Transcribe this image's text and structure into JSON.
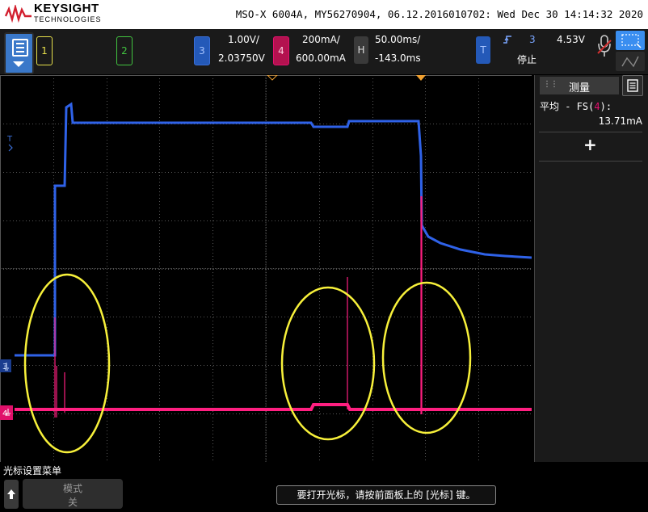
{
  "header": {
    "brand": "KEYSIGHT",
    "brand_sub": "TECHNOLOGIES",
    "model_info": "MSO-X 6004A, MY56270904, 06.12.2016010702: Wed Dec 30 14:14:32 2020"
  },
  "channels": [
    {
      "number": "1",
      "color": "#e7e04b"
    },
    {
      "number": "2",
      "color": "#42c540"
    },
    {
      "number": "3",
      "color": "#3a6fd8",
      "scale": "1.00V/",
      "offset": "2.03750V"
    },
    {
      "number": "4",
      "color": "#e5106f",
      "scale": "200mA/",
      "offset": "600.00mA"
    }
  ],
  "horizontal": {
    "label": "H",
    "timebase": "50.00ms/",
    "delay": "-143.0ms"
  },
  "trigger": {
    "label": "T",
    "source": "3",
    "level": "4.53V",
    "status": "停止"
  },
  "measurements": {
    "title": "测量",
    "label_prefix": "平均 - FS(",
    "label_channel": "4",
    "label_suffix": "):",
    "value": "13.71mA",
    "add_symbol": "+"
  },
  "markers": {
    "trigger_left": "T",
    "ch3_ground": "3",
    "ch4_ground": "4"
  },
  "bottom": {
    "menu_title": "光标设置菜单",
    "mode_label": "模式",
    "mode_value": "关",
    "status_message": "要打开光标，请按前面板上的 [光标] 键。"
  },
  "colors": {
    "ch3": "#2f62e8",
    "ch4": "#ff1f80",
    "annotation": "#f7f03a",
    "grid": "#555555",
    "trigger_marker": "#f0a030"
  }
}
